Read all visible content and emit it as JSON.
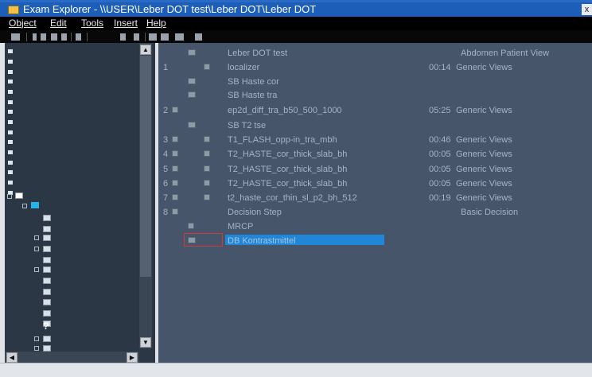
{
  "window": {
    "title": "Exam Explorer - \\\\USER\\Leber DOT test\\Leber DOT\\Leber DOT",
    "close_label": "x"
  },
  "menu": [
    {
      "label": "Object"
    },
    {
      "label": "Edit"
    },
    {
      "label": "Tools"
    },
    {
      "label": "Insert"
    },
    {
      "label": "Help"
    }
  ],
  "list": {
    "header": {
      "name": "Leber DOT test",
      "view": "Abdomen Patient View"
    },
    "rows": [
      {
        "num": "1",
        "name": "localizer",
        "time": "00:14",
        "view": "Generic Views"
      },
      {
        "num": "",
        "name": "SB Haste cor",
        "time": "",
        "view": ""
      },
      {
        "num": "",
        "name": "SB Haste tra",
        "time": "",
        "view": ""
      },
      {
        "num": "2",
        "name": "ep2d_diff_tra_b50_500_1000",
        "time": "05:25",
        "view": "Generic Views"
      },
      {
        "num": "",
        "name": "SB T2 tse",
        "time": "",
        "view": ""
      },
      {
        "num": "3",
        "name": "T1_FLASH_opp-in_tra_mbh",
        "time": "00:46",
        "view": "Generic Views"
      },
      {
        "num": "4",
        "name": "T2_HASTE_cor_thick_slab_bh",
        "time": "00:05",
        "view": "Generic Views"
      },
      {
        "num": "5",
        "name": "T2_HASTE_cor_thick_slab_bh",
        "time": "00:05",
        "view": "Generic Views"
      },
      {
        "num": "6",
        "name": "T2_HASTE_cor_thick_slab_bh",
        "time": "00:05",
        "view": "Generic Views"
      },
      {
        "num": "7",
        "name": "t2_haste_cor_thin_sl_p2_bh_512",
        "time": "00:19",
        "view": "Generic Views"
      },
      {
        "num": "8",
        "name": "Decision Step",
        "time": "",
        "view": "Basic Decision"
      },
      {
        "num": "",
        "name": "MRCP",
        "time": "",
        "view": ""
      },
      {
        "num": "",
        "name": "DB Kontrastmittel",
        "time": "",
        "view": ""
      }
    ]
  },
  "icons": {
    "app": "folder-icon",
    "tree_unknown": "question-mark-icon",
    "row_protocol": "protocol-icon",
    "row_step": "step-icon",
    "row_scan": "scan-icon"
  },
  "colors": {
    "title_bar": "#1d5fb8",
    "tree_bg": "#2b3745",
    "list_bg": "#46556a",
    "list_text": "#a4b4c4",
    "selection": "#1f86d8",
    "highlight_box": "#d23a3a"
  }
}
